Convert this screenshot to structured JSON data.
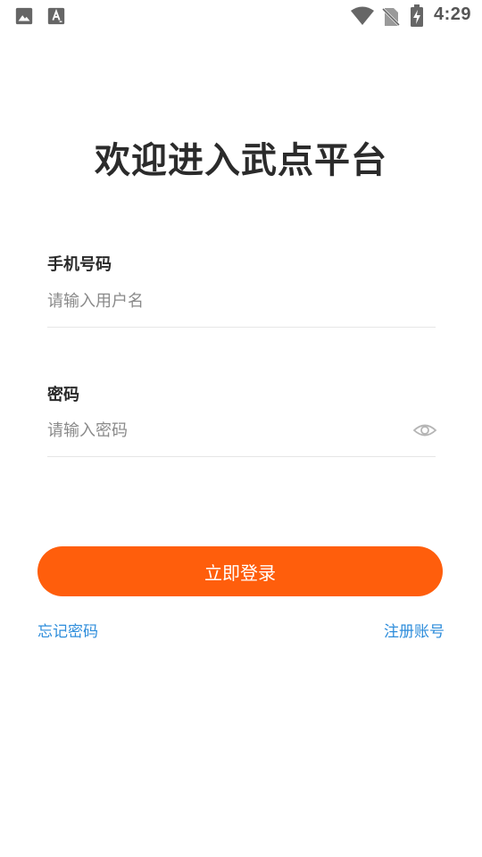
{
  "status_bar": {
    "time": "4:29",
    "left_icons": [
      "image-icon",
      "text-a-icon"
    ],
    "right_icons": [
      "wifi-icon",
      "no-sim-icon",
      "battery-charging-icon"
    ]
  },
  "title": "欢迎进入武点平台",
  "phone_field": {
    "label": "手机号码",
    "placeholder": "请输入用户名",
    "value": ""
  },
  "password_field": {
    "label": "密码",
    "placeholder": "请输入密码",
    "value": "",
    "toggle_icon": "eye-icon"
  },
  "login_button": {
    "label": "立即登录",
    "color": "#ff5e0c"
  },
  "links": {
    "forgot_password": "忘记密码",
    "register": "注册账号",
    "color": "#2e8ddb"
  }
}
